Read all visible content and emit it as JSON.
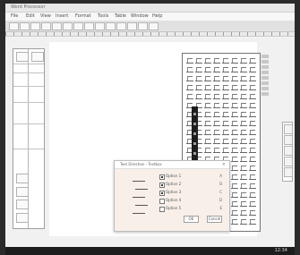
{
  "window": {
    "title": "Word Processor"
  },
  "menu": [
    {
      "label": "File"
    },
    {
      "label": "Edit"
    },
    {
      "label": "View"
    },
    {
      "label": "Insert"
    },
    {
      "label": "Format"
    },
    {
      "label": "Tools"
    },
    {
      "label": "Table"
    },
    {
      "label": "Window"
    },
    {
      "label": "Help"
    }
  ],
  "dialog": {
    "title": "Text Direction - Textbox",
    "close": "×",
    "options": [
      {
        "label": "Option 1",
        "value": "A",
        "checked": true
      },
      {
        "label": "Option 2",
        "value": "B",
        "checked": true
      },
      {
        "label": "Option 3",
        "value": "C",
        "checked": true
      },
      {
        "label": "Option 4",
        "value": "D",
        "checked": false
      },
      {
        "label": "Option 5",
        "value": "E",
        "checked": false
      }
    ],
    "buttons": [
      {
        "label": "OK"
      },
      {
        "label": "Cancel"
      }
    ]
  },
  "taskbar": {
    "clock": "12:34"
  }
}
